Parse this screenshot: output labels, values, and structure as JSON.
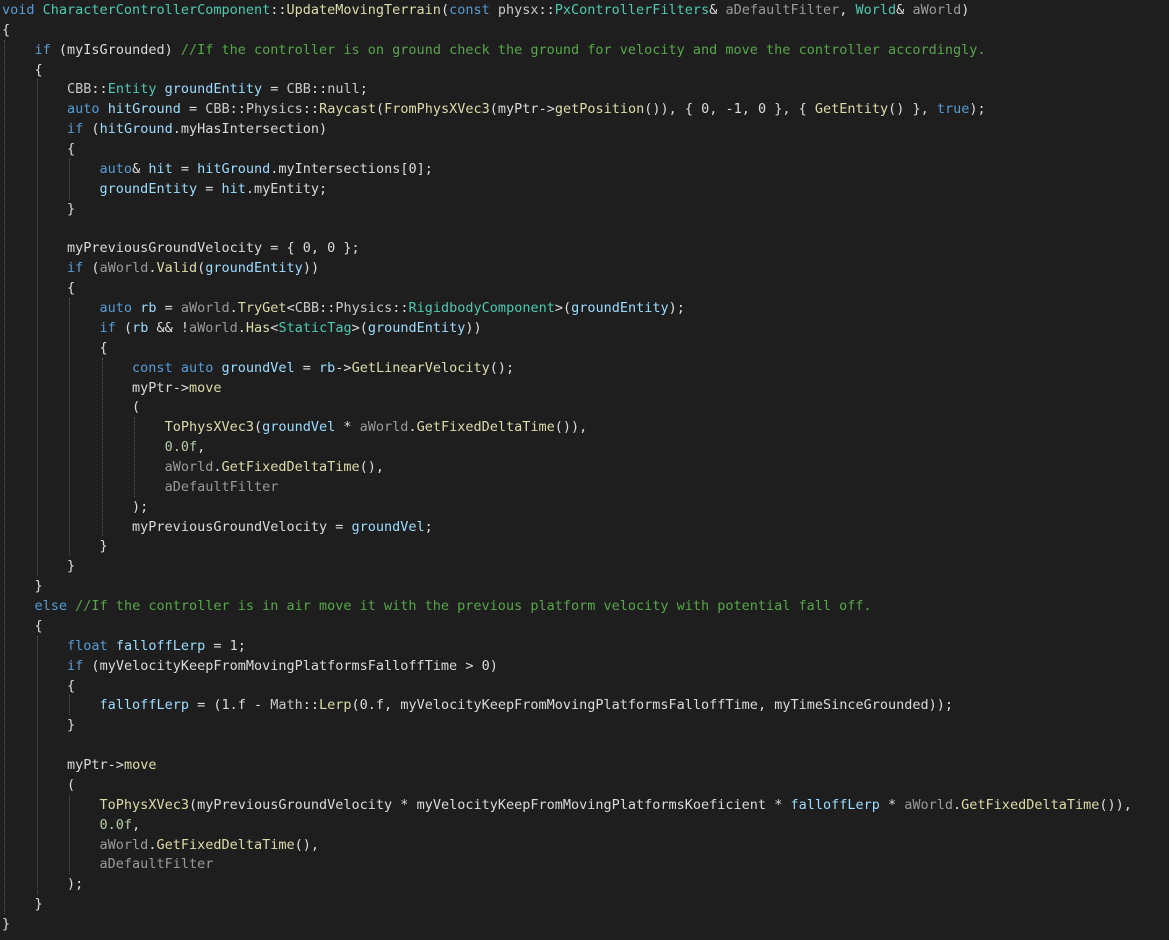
{
  "editor": {
    "lines": [
      [
        [
          "kw",
          "void"
        ],
        [
          "pl",
          " "
        ],
        [
          "ty",
          "CharacterControllerComponent"
        ],
        [
          "pl",
          "::"
        ],
        [
          "fn",
          "UpdateMovingTerrain"
        ],
        [
          "pl",
          "("
        ],
        [
          "kw",
          "const"
        ],
        [
          "pl",
          " "
        ],
        [
          "ns",
          "physx"
        ],
        [
          "pl",
          "::"
        ],
        [
          "ty",
          "PxControllerFilters"
        ],
        [
          "pl",
          "& "
        ],
        [
          "pm",
          "aDefaultFilter"
        ],
        [
          "pl",
          ", "
        ],
        [
          "ty",
          "World"
        ],
        [
          "pl",
          "& "
        ],
        [
          "pm",
          "aWorld"
        ],
        [
          "pl",
          ")"
        ]
      ],
      [
        [
          "pl",
          "{"
        ]
      ],
      [
        [
          "pl",
          "    "
        ],
        [
          "kw",
          "if"
        ],
        [
          "pl",
          " ("
        ],
        [
          "mb",
          "myIsGrounded"
        ],
        [
          "pl",
          ") "
        ],
        [
          "cm",
          "//If the controller is on ground check the ground for velocity and move the controller accordingly."
        ]
      ],
      [
        [
          "pl",
          "    {"
        ]
      ],
      [
        [
          "pl",
          "        "
        ],
        [
          "ns",
          "CBB"
        ],
        [
          "pl",
          "::"
        ],
        [
          "ty",
          "Entity"
        ],
        [
          "pl",
          " "
        ],
        [
          "lv",
          "groundEntity"
        ],
        [
          "pl",
          " = "
        ],
        [
          "ns",
          "CBB"
        ],
        [
          "pl",
          "::"
        ],
        [
          "ns",
          "null"
        ],
        [
          "pl",
          ";"
        ]
      ],
      [
        [
          "pl",
          "        "
        ],
        [
          "kw",
          "auto"
        ],
        [
          "pl",
          " "
        ],
        [
          "lv",
          "hitGround"
        ],
        [
          "pl",
          " = "
        ],
        [
          "ns",
          "CBB"
        ],
        [
          "pl",
          "::"
        ],
        [
          "ns",
          "Physics"
        ],
        [
          "pl",
          "::"
        ],
        [
          "fn",
          "Raycast"
        ],
        [
          "pl",
          "("
        ],
        [
          "fn",
          "FromPhysXVec3"
        ],
        [
          "pl",
          "("
        ],
        [
          "mb",
          "myPtr"
        ],
        [
          "pl",
          "->"
        ],
        [
          "fn",
          "getPosition"
        ],
        [
          "pl",
          "()), { 0, -1, 0 }, { "
        ],
        [
          "fn",
          "GetEntity"
        ],
        [
          "pl",
          "() }, "
        ],
        [
          "kw",
          "true"
        ],
        [
          "pl",
          ");"
        ]
      ],
      [
        [
          "pl",
          "        "
        ],
        [
          "kw",
          "if"
        ],
        [
          "pl",
          " ("
        ],
        [
          "lv",
          "hitGround"
        ],
        [
          "pl",
          "."
        ],
        [
          "mb",
          "myHasIntersection"
        ],
        [
          "pl",
          ")"
        ]
      ],
      [
        [
          "pl",
          "        {"
        ]
      ],
      [
        [
          "pl",
          "            "
        ],
        [
          "kw",
          "auto"
        ],
        [
          "pl",
          "& "
        ],
        [
          "lv",
          "hit"
        ],
        [
          "pl",
          " = "
        ],
        [
          "lv",
          "hitGround"
        ],
        [
          "pl",
          "."
        ],
        [
          "mb",
          "myIntersections"
        ],
        [
          "pl",
          "[0];"
        ]
      ],
      [
        [
          "pl",
          "            "
        ],
        [
          "lv",
          "groundEntity"
        ],
        [
          "pl",
          " = "
        ],
        [
          "lv",
          "hit"
        ],
        [
          "pl",
          "."
        ],
        [
          "mb",
          "myEntity"
        ],
        [
          "pl",
          ";"
        ]
      ],
      [
        [
          "pl",
          "        }"
        ]
      ],
      [
        [
          "pl",
          ""
        ]
      ],
      [
        [
          "pl",
          "        "
        ],
        [
          "mb",
          "myPreviousGroundVelocity"
        ],
        [
          "pl",
          " = { 0, 0 };"
        ]
      ],
      [
        [
          "pl",
          "        "
        ],
        [
          "kw",
          "if"
        ],
        [
          "pl",
          " ("
        ],
        [
          "pm",
          "aWorld"
        ],
        [
          "pl",
          "."
        ],
        [
          "fn",
          "Valid"
        ],
        [
          "pl",
          "("
        ],
        [
          "lv",
          "groundEntity"
        ],
        [
          "pl",
          "))"
        ]
      ],
      [
        [
          "pl",
          "        {"
        ]
      ],
      [
        [
          "pl",
          "            "
        ],
        [
          "kw",
          "auto"
        ],
        [
          "pl",
          " "
        ],
        [
          "lv",
          "rb"
        ],
        [
          "pl",
          " = "
        ],
        [
          "pm",
          "aWorld"
        ],
        [
          "pl",
          "."
        ],
        [
          "fn",
          "TryGet"
        ],
        [
          "pl",
          "<"
        ],
        [
          "ns",
          "CBB"
        ],
        [
          "pl",
          "::"
        ],
        [
          "ns",
          "Physics"
        ],
        [
          "pl",
          "::"
        ],
        [
          "ty",
          "RigidbodyComponent"
        ],
        [
          "pl",
          ">("
        ],
        [
          "lv",
          "groundEntity"
        ],
        [
          "pl",
          ");"
        ]
      ],
      [
        [
          "pl",
          "            "
        ],
        [
          "kw",
          "if"
        ],
        [
          "pl",
          " ("
        ],
        [
          "lv",
          "rb"
        ],
        [
          "pl",
          " && !"
        ],
        [
          "pm",
          "aWorld"
        ],
        [
          "pl",
          "."
        ],
        [
          "fn",
          "Has"
        ],
        [
          "pl",
          "<"
        ],
        [
          "ty",
          "StaticTag"
        ],
        [
          "pl",
          ">("
        ],
        [
          "lv",
          "groundEntity"
        ],
        [
          "pl",
          "))"
        ]
      ],
      [
        [
          "pl",
          "            {"
        ]
      ],
      [
        [
          "pl",
          "                "
        ],
        [
          "kw",
          "const"
        ],
        [
          "pl",
          " "
        ],
        [
          "kw",
          "auto"
        ],
        [
          "pl",
          " "
        ],
        [
          "lv",
          "groundVel"
        ],
        [
          "pl",
          " = "
        ],
        [
          "lv",
          "rb"
        ],
        [
          "pl",
          "->"
        ],
        [
          "fn",
          "GetLinearVelocity"
        ],
        [
          "pl",
          "();"
        ]
      ],
      [
        [
          "pl",
          "                "
        ],
        [
          "mb",
          "myPtr"
        ],
        [
          "pl",
          "->"
        ],
        [
          "fn",
          "move"
        ]
      ],
      [
        [
          "pl",
          "                ("
        ]
      ],
      [
        [
          "pl",
          "                    "
        ],
        [
          "fn",
          "ToPhysXVec3"
        ],
        [
          "pl",
          "("
        ],
        [
          "lv",
          "groundVel"
        ],
        [
          "pl",
          " * "
        ],
        [
          "pm",
          "aWorld"
        ],
        [
          "pl",
          "."
        ],
        [
          "fn",
          "GetFixedDeltaTime"
        ],
        [
          "pl",
          "()),"
        ]
      ],
      [
        [
          "pl",
          "                    "
        ],
        [
          "nm",
          "0.0f"
        ],
        [
          "pl",
          ","
        ]
      ],
      [
        [
          "pl",
          "                    "
        ],
        [
          "pm",
          "aWorld"
        ],
        [
          "pl",
          "."
        ],
        [
          "fn",
          "GetFixedDeltaTime"
        ],
        [
          "pl",
          "(),"
        ]
      ],
      [
        [
          "pl",
          "                    "
        ],
        [
          "pm",
          "aDefaultFilter"
        ]
      ],
      [
        [
          "pl",
          "                );"
        ]
      ],
      [
        [
          "pl",
          "                "
        ],
        [
          "mb",
          "myPreviousGroundVelocity"
        ],
        [
          "pl",
          " = "
        ],
        [
          "lv",
          "groundVel"
        ],
        [
          "pl",
          ";"
        ]
      ],
      [
        [
          "pl",
          "            }"
        ]
      ],
      [
        [
          "pl",
          "        }"
        ]
      ],
      [
        [
          "pl",
          "    }"
        ]
      ],
      [
        [
          "pl",
          "    "
        ],
        [
          "kw",
          "else"
        ],
        [
          "pl",
          " "
        ],
        [
          "cm",
          "//If the controller is in air move it with the previous platform velocity with potential fall off."
        ]
      ],
      [
        [
          "pl",
          "    {"
        ]
      ],
      [
        [
          "pl",
          "        "
        ],
        [
          "kw",
          "float"
        ],
        [
          "pl",
          " "
        ],
        [
          "lv",
          "falloffLerp"
        ],
        [
          "pl",
          " = 1;"
        ]
      ],
      [
        [
          "pl",
          "        "
        ],
        [
          "kw",
          "if"
        ],
        [
          "pl",
          " ("
        ],
        [
          "mb",
          "myVelocityKeepFromMovingPlatformsFalloffTime"
        ],
        [
          "pl",
          " > 0)"
        ]
      ],
      [
        [
          "pl",
          "        {"
        ]
      ],
      [
        [
          "pl",
          "            "
        ],
        [
          "lv",
          "falloffLerp"
        ],
        [
          "pl",
          " = (1.f - "
        ],
        [
          "ns",
          "Math"
        ],
        [
          "pl",
          "::"
        ],
        [
          "fn",
          "Lerp"
        ],
        [
          "pl",
          "(0.f, "
        ],
        [
          "mb",
          "myVelocityKeepFromMovingPlatformsFalloffTime"
        ],
        [
          "pl",
          ", "
        ],
        [
          "mb",
          "myTimeSinceGrounded"
        ],
        [
          "pl",
          "));"
        ]
      ],
      [
        [
          "pl",
          "        }"
        ]
      ],
      [
        [
          "pl",
          ""
        ]
      ],
      [
        [
          "pl",
          "        "
        ],
        [
          "mb",
          "myPtr"
        ],
        [
          "pl",
          "->"
        ],
        [
          "fn",
          "move"
        ]
      ],
      [
        [
          "pl",
          "        ("
        ]
      ],
      [
        [
          "pl",
          "            "
        ],
        [
          "fn",
          "ToPhysXVec3"
        ],
        [
          "pl",
          "("
        ],
        [
          "mb",
          "myPreviousGroundVelocity"
        ],
        [
          "pl",
          " * "
        ],
        [
          "mb",
          "myVelocityKeepFromMovingPlatformsKoeficient"
        ],
        [
          "pl",
          " * "
        ],
        [
          "lv",
          "falloffLerp"
        ],
        [
          "pl",
          " * "
        ],
        [
          "pm",
          "aWorld"
        ],
        [
          "pl",
          "."
        ],
        [
          "fn",
          "GetFixedDeltaTime"
        ],
        [
          "pl",
          "()),"
        ]
      ],
      [
        [
          "pl",
          "            "
        ],
        [
          "nm",
          "0.0f"
        ],
        [
          "pl",
          ","
        ]
      ],
      [
        [
          "pl",
          "            "
        ],
        [
          "pm",
          "aWorld"
        ],
        [
          "pl",
          "."
        ],
        [
          "fn",
          "GetFixedDeltaTime"
        ],
        [
          "pl",
          "(),"
        ]
      ],
      [
        [
          "pl",
          "            "
        ],
        [
          "pm",
          "aDefaultFilter"
        ]
      ],
      [
        [
          "pl",
          "        );"
        ]
      ],
      [
        [
          "pl",
          "    }"
        ]
      ],
      [
        [
          "pl",
          "}"
        ]
      ]
    ]
  }
}
